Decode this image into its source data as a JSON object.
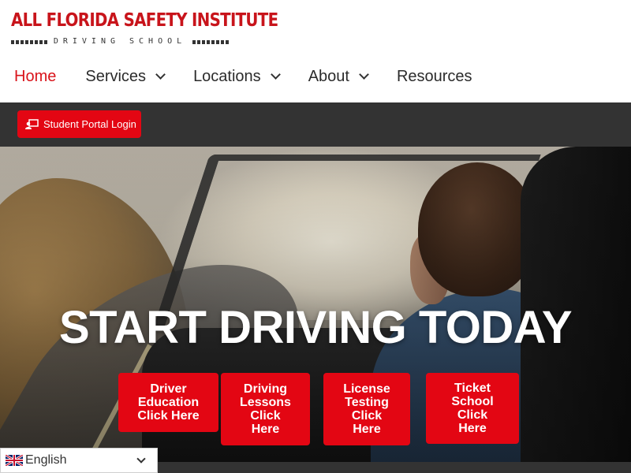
{
  "logo": {
    "title": "ALL FLORIDA SAFETY INSTITUTE",
    "subtitle": "DRIVING SCHOOL"
  },
  "nav": {
    "items": [
      {
        "label": "Home",
        "active": true,
        "has_dropdown": false
      },
      {
        "label": "Services",
        "active": false,
        "has_dropdown": true
      },
      {
        "label": "Locations",
        "active": false,
        "has_dropdown": true
      },
      {
        "label": "About",
        "active": false,
        "has_dropdown": true
      },
      {
        "label": "Resources",
        "active": false,
        "has_dropdown": false
      }
    ]
  },
  "portal": {
    "label": "Student Portal Login",
    "icon": "user-screen-icon"
  },
  "hero": {
    "title": "START DRIVING TODAY",
    "buttons": [
      {
        "label": "Driver\nEducation\nClick Here"
      },
      {
        "label": "Driving\nLessons\nClick\nHere"
      },
      {
        "label": "License\nTesting\nClick\nHere"
      },
      {
        "label": "Ticket\nSchool\nClick\nHere"
      }
    ]
  },
  "language": {
    "label": "English",
    "icon": "uk-flag-icon"
  },
  "colors": {
    "brand_red": "#e30613",
    "nav_active": "#d9141b",
    "dark_bar": "#333333",
    "text": "#2b2b2b"
  }
}
